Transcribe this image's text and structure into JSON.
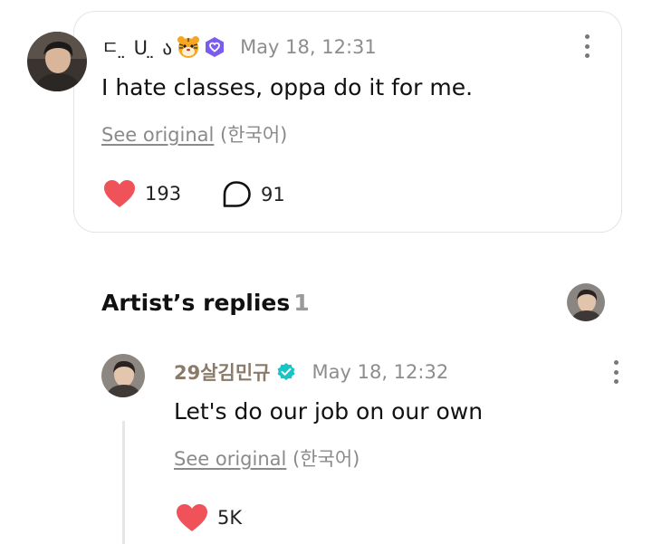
{
  "post": {
    "author_name": "ㄷ  ̤ ᑌ  ̤ ა",
    "timestamp": "May 18, 12:31",
    "text": "I hate classes, oppa do it for me.",
    "see_original_link": "See original",
    "see_original_lang": "(한국어)",
    "likes": "193",
    "comments": "91"
  },
  "artist_replies": {
    "title": "Artist’s replies",
    "count": "1"
  },
  "reply": {
    "author_name": "29살김민규",
    "timestamp": "May 18, 12:32",
    "text": "Let's do our job on our own",
    "see_original_link": "See original",
    "see_original_lang": "(한국어)",
    "likes": "5K"
  },
  "colors": {
    "heart": "#f0525a",
    "membership_badge": "#7b5cf0",
    "verified_badge": "#17c6c4",
    "card_border": "#e4e4e4"
  },
  "icons": {
    "fan_badge": "tiger-face-icon",
    "membership": "membership-badge-icon",
    "verified": "verified-badge-icon",
    "like": "heart-icon",
    "comment": "comment-bubble-icon",
    "more": "more-vertical-icon"
  }
}
